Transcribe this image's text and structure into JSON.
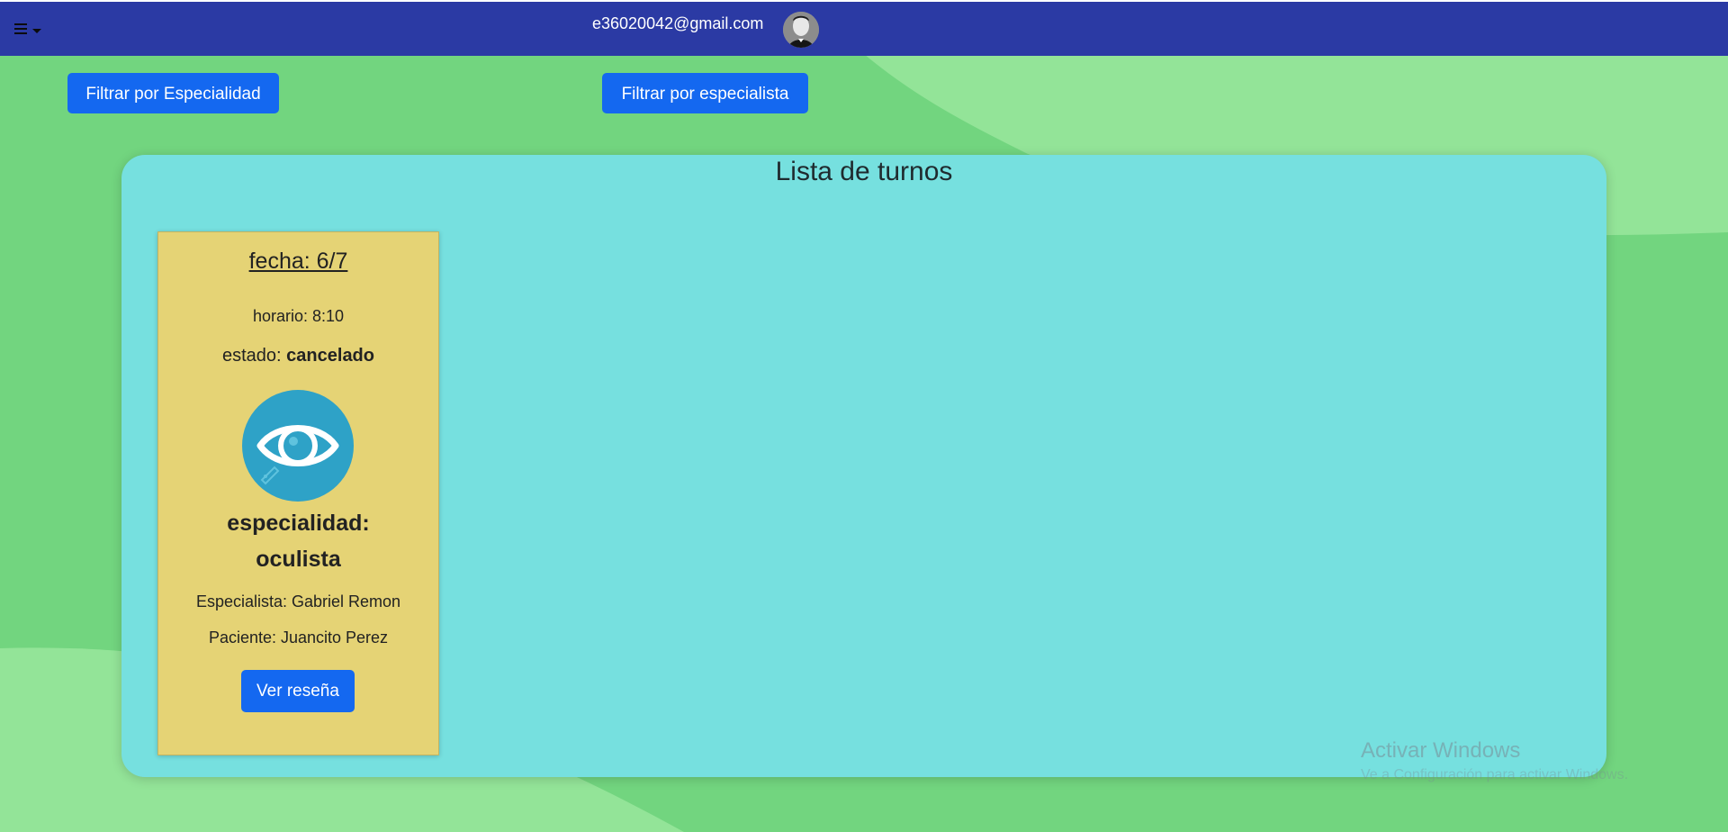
{
  "header": {
    "user_email": "e36020042@gmail.com"
  },
  "filters": {
    "by_specialty_label": "Filtrar por Especialidad",
    "by_specialist_label": "Filtrar por especialista"
  },
  "panel": {
    "title": "Lista de turnos"
  },
  "appointments": [
    {
      "date": "fecha: 6/7",
      "time": "horario: 8:10",
      "state_prefix": "estado: ",
      "state_value": "cancelado",
      "specialty_line1": "especialidad:",
      "specialty_line2": "oculista",
      "specialist": "Especialista: Gabriel Remon",
      "patient": "Paciente: Juancito Perez",
      "review_button": "Ver reseña",
      "icon": "eye-icon"
    }
  ],
  "watermark": {
    "title": "Activar Windows",
    "subtitle": "Ve a Configuración para activar Windows."
  },
  "colors": {
    "navbar": "#2b3aa4",
    "background": "#72d57f",
    "panel": "#76e0df",
    "card": "#e5d375",
    "button": "#1468f0",
    "icon_circle": "#2ea2c7"
  }
}
